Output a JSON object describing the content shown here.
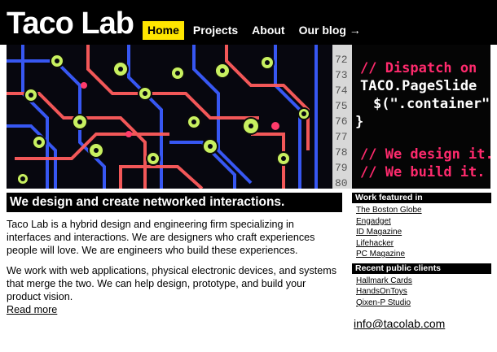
{
  "header": {
    "logo": "Taco Lab",
    "nav": [
      {
        "label": "Home",
        "active": true
      },
      {
        "label": "Projects",
        "active": false
      },
      {
        "label": "About",
        "active": false
      },
      {
        "label": "Our blog →",
        "active": false
      }
    ]
  },
  "banner": {
    "line_numbers": [
      "72",
      "73",
      "74",
      "75",
      "76",
      "77",
      "78",
      "79",
      "80"
    ],
    "code_lines": [
      "// Dispatch on",
      "TACO.PageSlide",
      "$(\".container\")",
      "}",
      "",
      "// We design it.",
      "// We build it."
    ],
    "colors": {
      "comment": "#ff2a6d",
      "code": "#ffffff",
      "trace_red": "#ff5c5c",
      "trace_blue": "#3a5cff",
      "pad": "#c8f060"
    }
  },
  "tagline": "We design and create networked interactions.",
  "main": {
    "para1": "Taco Lab is a hybrid design and engineering firm specializing in interfaces and interactions. We are designers who craft experiences people will love. We are engineers who build these experiences.",
    "para2": "We work with web applications, physical electronic devices, and systems that merge the two. We can help design, prototype, and build your product vision.",
    "read_more": "Read more"
  },
  "sidebar": {
    "featured_title": "Work featured in",
    "featured": [
      "The Boston Globe",
      "Engadget",
      "ID Magazine",
      "Lifehacker",
      "PC Magazine"
    ],
    "clients_title": "Recent public clients",
    "clients": [
      "Hallmark Cards",
      "HandsOnToys",
      "Qixen-P Studio"
    ],
    "email": "info@tacolab.com"
  }
}
